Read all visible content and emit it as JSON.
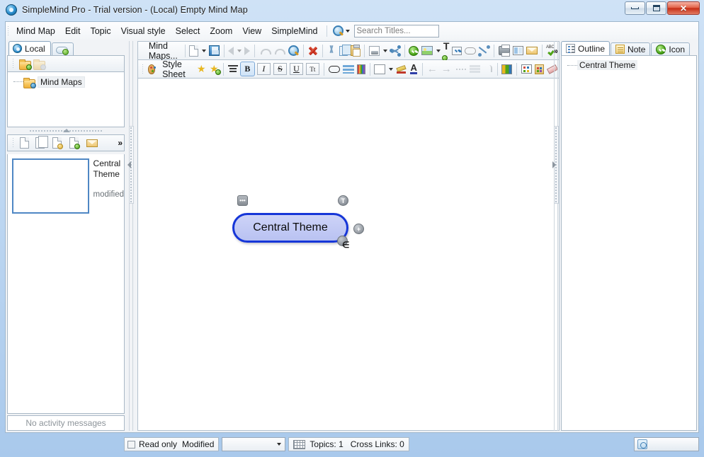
{
  "window": {
    "title": "SimpleMind Pro - Trial version - (Local) Empty Mind Map",
    "app_icon": "simplemind-logo-icon",
    "buttons": {
      "minimize": "minimize-icon",
      "maximize": "maximize-icon",
      "close": "✕"
    }
  },
  "menubar": {
    "items": [
      "Mind Map",
      "Edit",
      "Topic",
      "Visual style",
      "Select",
      "Zoom",
      "View",
      "SimpleMind"
    ],
    "search": {
      "icon": "search-magnifier-icon",
      "placeholder": "Search Titles...",
      "value": ""
    }
  },
  "left_panel": {
    "tabs": [
      {
        "label": "Local",
        "icon": "local-disc-icon",
        "active": true
      },
      {
        "label": "",
        "icon": "cloud-add-icon",
        "active": false
      }
    ],
    "tree_toolbar": [
      {
        "name": "new-folder-button",
        "icon": "folder-add-icon",
        "enabled": true
      },
      {
        "name": "delete-folder-button",
        "icon": "folder-delete-icon",
        "enabled": false
      }
    ],
    "tree": {
      "root_label": "Mind Maps",
      "root_icon": "folder-icon"
    },
    "file_toolbar": [
      {
        "name": "new-file-button",
        "icon": "page-icon"
      },
      {
        "name": "duplicate-file-button",
        "icon": "pages-icon"
      },
      {
        "name": "import-file-button",
        "icon": "page-import-icon"
      },
      {
        "name": "export-file-button",
        "icon": "page-export-icon"
      },
      {
        "name": "mail-file-button",
        "icon": "mail-icon"
      },
      {
        "name": "overflow-button",
        "icon": "chevron-double-right-icon"
      }
    ],
    "file_item": {
      "title_line1": "Central",
      "title_line2": "Theme",
      "status": "modified"
    },
    "activity": "No activity messages"
  },
  "toolbar_main": {
    "mindmaps_label": "Mind Maps...",
    "buttons": [
      {
        "name": "new-mindmap-button",
        "icon": "new-page-icon",
        "has_dropdown": true,
        "enabled": true
      },
      {
        "name": "save-button",
        "icon": "floppy-save-icon",
        "enabled": true
      },
      {
        "name": "back-button",
        "icon": "left-triangle-icon",
        "enabled": false
      },
      {
        "name": "history-dropdown-button",
        "icon": "chevron-down-icon",
        "enabled": false
      },
      {
        "name": "forward-button",
        "icon": "right-triangle-icon",
        "enabled": false
      },
      {
        "name": "undo-button",
        "icon": "undo-arrow-icon",
        "enabled": false
      },
      {
        "name": "redo-button",
        "icon": "redo-arrow-icon",
        "enabled": false
      },
      {
        "name": "find-button",
        "icon": "magnifier-icon",
        "enabled": true
      },
      {
        "name": "delete-button",
        "icon": "red-x-icon",
        "enabled": true
      },
      {
        "name": "cut-button",
        "icon": "scissors-icon",
        "enabled": true
      },
      {
        "name": "copy-button",
        "icon": "copy-pages-icon",
        "enabled": true
      },
      {
        "name": "paste-button",
        "icon": "clipboard-icon",
        "enabled": true
      },
      {
        "name": "export-button",
        "icon": "page-export-icon",
        "has_dropdown": true,
        "enabled": true
      },
      {
        "name": "share-button",
        "icon": "share-nodes-icon",
        "enabled": true
      },
      {
        "name": "checkmark-button",
        "icon": "green-check-circle-icon",
        "enabled": true
      },
      {
        "name": "insert-image-button",
        "icon": "picture-icon",
        "has_dropdown": true,
        "enabled": true
      },
      {
        "name": "add-text-button",
        "icon": "text-add-icon",
        "enabled": true
      },
      {
        "name": "checkbox-button",
        "icon": "checkbox-icon",
        "enabled": true
      },
      {
        "name": "shape-button",
        "icon": "shape-icon",
        "enabled": false
      },
      {
        "name": "crosslink-button",
        "icon": "link-arrow-icon",
        "enabled": true
      },
      {
        "name": "print-button",
        "icon": "printer-icon",
        "enabled": true
      },
      {
        "name": "layout-button",
        "icon": "layout-icon",
        "enabled": true
      },
      {
        "name": "email-button",
        "icon": "mail-icon",
        "enabled": true
      },
      {
        "name": "spellcheck-button",
        "icon": "abc-check-icon",
        "enabled": true
      },
      {
        "name": "toolbar-overflow-button",
        "icon": "chevron-double-right-icon",
        "enabled": true
      }
    ]
  },
  "toolbar_style": {
    "style_sheet_label": "Style Sheet",
    "buttons": [
      {
        "name": "stylesheet-palette-icon",
        "icon": "palette-icon"
      },
      {
        "name": "favorite-style-button",
        "icon": "star-icon"
      },
      {
        "name": "add-favorite-style-button",
        "icon": "star-add-icon"
      },
      {
        "name": "align-button",
        "icon": "align-icon"
      },
      {
        "name": "bold-button",
        "label": "B",
        "active": true
      },
      {
        "name": "italic-button",
        "label": "I"
      },
      {
        "name": "strikethrough-button",
        "label": "S"
      },
      {
        "name": "underline-button",
        "label": "U"
      },
      {
        "name": "font-size-button",
        "label": "Tt"
      },
      {
        "name": "border-shape-button",
        "icon": "rounded-rect-icon"
      },
      {
        "name": "line-style-button",
        "icon": "lines-icon"
      },
      {
        "name": "color-bars-button",
        "icon": "color-bars-icon"
      },
      {
        "name": "fill-color-button",
        "icon": "white-swatch-icon",
        "has_dropdown": true
      },
      {
        "name": "highlighter-button",
        "icon": "highlighter-pencil-icon"
      },
      {
        "name": "font-color-button",
        "icon": "font-color-A-icon"
      },
      {
        "name": "arrow-left-button",
        "icon": "arrow-left-icon",
        "enabled": false
      },
      {
        "name": "arrow-right-button",
        "icon": "arrow-right-icon",
        "enabled": false
      },
      {
        "name": "dotted-line-button",
        "icon": "dotted-line-icon",
        "enabled": false
      },
      {
        "name": "stack-lines-button",
        "icon": "stacked-lines-icon",
        "enabled": false
      },
      {
        "name": "curve-button",
        "icon": "curve-icon",
        "enabled": false
      },
      {
        "name": "color-grid-button",
        "icon": "color-grid-icon"
      },
      {
        "name": "palette-grid-button",
        "icon": "palette-grid-icon"
      },
      {
        "name": "clipboard-colors-button",
        "icon": "clipboard-colors-icon"
      },
      {
        "name": "eraser-button",
        "icon": "eraser-icon"
      }
    ]
  },
  "canvas": {
    "node": {
      "text": "Central Theme",
      "border_color": "#1636d8",
      "fill_color": "#c3cbf5"
    },
    "handles": [
      {
        "name": "node-menu-handle",
        "glyph": "•••"
      },
      {
        "name": "node-text-handle",
        "glyph": "T"
      },
      {
        "name": "node-add-child-handle",
        "glyph": "+"
      },
      {
        "name": "node-link-handle",
        "glyph": ""
      }
    ]
  },
  "right_panel": {
    "tabs": [
      {
        "label": "Outline",
        "icon": "outline-list-icon",
        "active": true
      },
      {
        "label": "Note",
        "icon": "note-icon",
        "active": false
      },
      {
        "label": "Icon",
        "icon": "green-check-circle-icon",
        "active": false
      }
    ],
    "outline_items": [
      "Central Theme"
    ]
  },
  "statusbar": {
    "read_only_label": "Read only",
    "read_only_checked": false,
    "modified_label": "Modified",
    "style_combo_value": "",
    "grid_icon": "grid-icon",
    "topics_label": "Topics: 1",
    "crosslinks_label": "Cross Links: 0",
    "zoom_icon": "zoom-preview-icon"
  }
}
